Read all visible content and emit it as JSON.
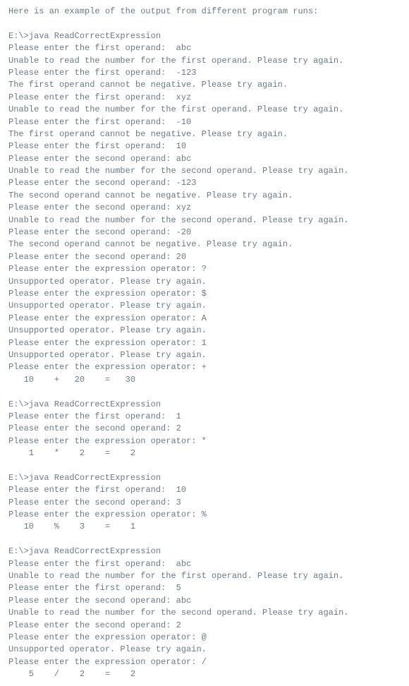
{
  "lines": [
    "Here is an example of the output from different program runs:",
    "",
    "E:\\>java ReadCorrectExpression",
    "Please enter the first operand:  abc",
    "Unable to read the number for the first operand. Please try again.",
    "Please enter the first operand:  -123",
    "The first operand cannot be negative. Please try again.",
    "Please enter the first operand:  xyz",
    "Unable to read the number for the first operand. Please try again.",
    "Please enter the first operand:  -10",
    "The first operand cannot be negative. Please try again.",
    "Please enter the first operand:  10",
    "Please enter the second operand: abc",
    "Unable to read the number for the second operand. Please try again.",
    "Please enter the second operand: -123",
    "The second operand cannot be negative. Please try again.",
    "Please enter the second operand: xyz",
    "Unable to read the number for the second operand. Please try again.",
    "Please enter the second operand: -20",
    "The second operand cannot be negative. Please try again.",
    "Please enter the second operand: 20",
    "Please enter the expression operator: ?",
    "Unsupported operator. Please try again.",
    "Please enter the expression operator: $",
    "Unsupported operator. Please try again.",
    "Please enter the expression operator: A",
    "Unsupported operator. Please try again.",
    "Please enter the expression operator: 1",
    "Unsupported operator. Please try again.",
    "Please enter the expression operator: +",
    "   10    +   20    =   30",
    "",
    "E:\\>java ReadCorrectExpression",
    "Please enter the first operand:  1",
    "Please enter the second operand: 2",
    "Please enter the expression operator: *",
    "    1    *    2    =    2",
    "",
    "E:\\>java ReadCorrectExpression",
    "Please enter the first operand:  10",
    "Please enter the second operand: 3",
    "Please enter the expression operator: %",
    "   10    %    3    =    1",
    "",
    "E:\\>java ReadCorrectExpression",
    "Please enter the first operand:  abc",
    "Unable to read the number for the first operand. Please try again.",
    "Please enter the first operand:  5",
    "Please enter the second operand: abc",
    "Unable to read the number for the second operand. Please try again.",
    "Please enter the second operand: 2",
    "Please enter the expression operator: @",
    "Unsupported operator. Please try again.",
    "Please enter the expression operator: /",
    "    5    /    2    =    2"
  ]
}
